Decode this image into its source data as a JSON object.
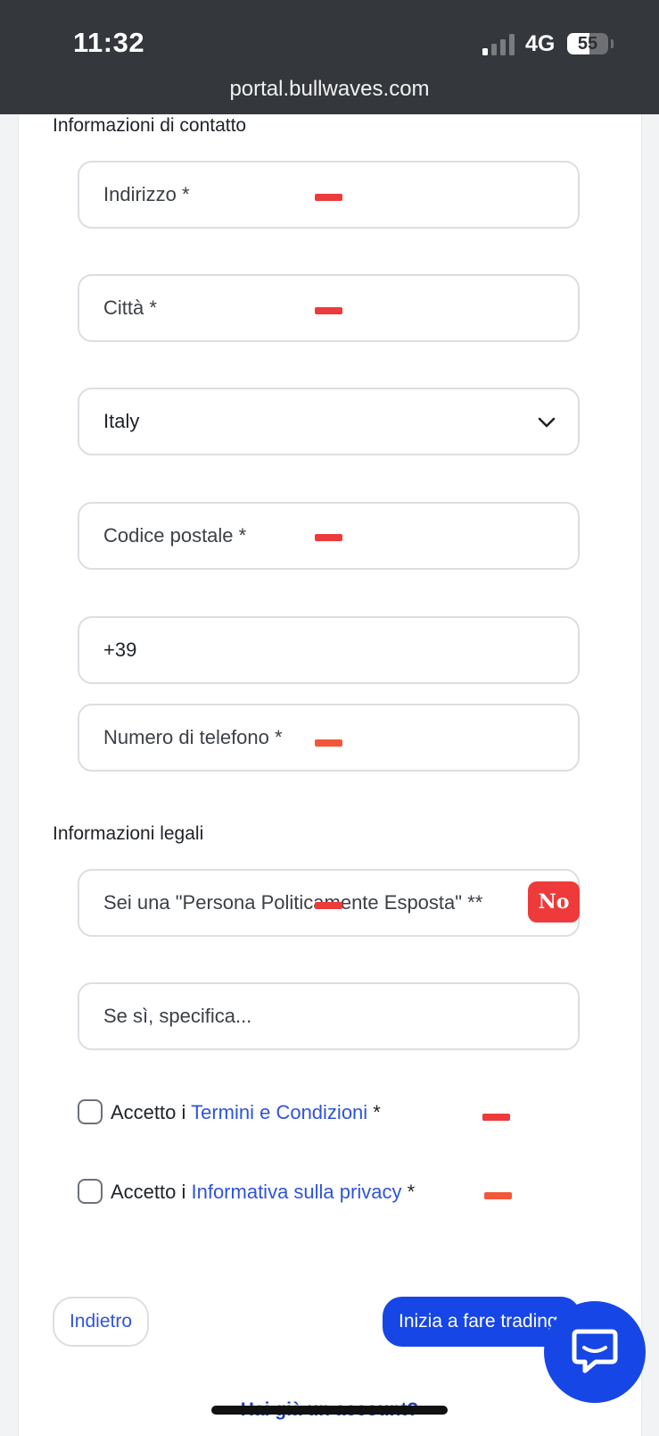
{
  "status_bar": {
    "time": "11:32",
    "network": "4G",
    "battery": "55",
    "battery_fraction": 0.55,
    "url": "portal.bullwaves.com",
    "signal_bars_active": 1,
    "signal_bars_total": 4
  },
  "contact_section": {
    "title": "Informazioni di contatto",
    "address_label": "Indirizzo  *",
    "city_label": "Città  *",
    "country_value": "Italy",
    "postal_label": "Codice postale  *",
    "phone_prefix": "+39",
    "phone_label": "Numero di telefono  *"
  },
  "legal_section": {
    "title": "Informazioni legali",
    "pep_label": "Sei una \"Persona Politicamente Esposta\" **",
    "pep_badge": "No",
    "pep_specify_placeholder": "Se sì, specifica..."
  },
  "checkboxes": {
    "terms_prefix": "Accetto i ",
    "terms_link": "Termini e Condizioni",
    "terms_suffix": " *",
    "privacy_prefix": "Accetto i ",
    "privacy_link": "Informativa sulla privacy",
    "privacy_suffix": " *"
  },
  "buttons": {
    "back": "Indietro",
    "start": "Inizia a fare trading"
  },
  "footer": {
    "login_prompt": "Hai già un account?"
  },
  "colors": {
    "accent": "#1746e6",
    "link": "#2f54d9",
    "error_mark": "#ee3a3a",
    "status_bar": "#34373b"
  },
  "icons": [
    "signal-icon",
    "battery-icon",
    "chevron-down-icon",
    "chat-bubble-icon"
  ]
}
